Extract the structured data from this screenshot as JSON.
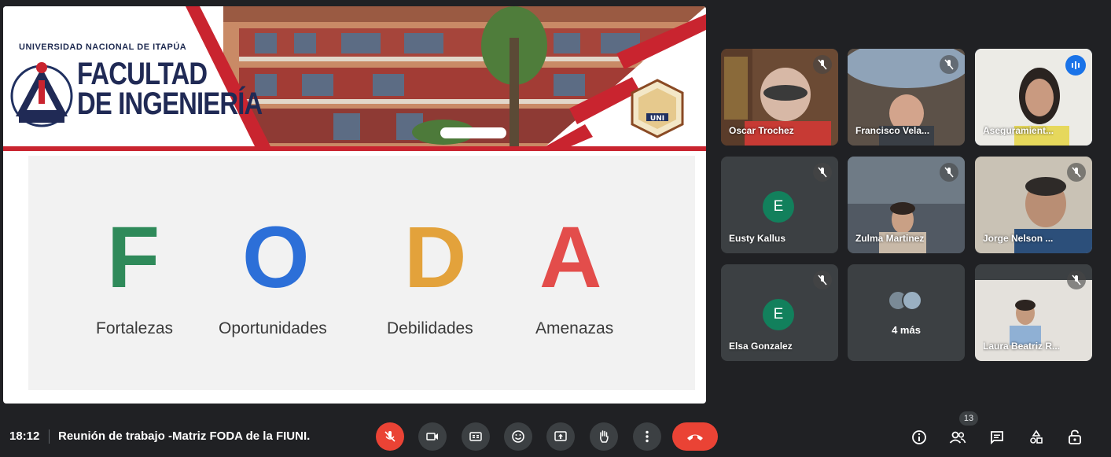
{
  "slide": {
    "university": "UNIVERSIDAD NACIONAL DE ITAPÚA",
    "faculty_line1": "FACULTAD",
    "faculty_line2": "DE INGENIERÍA",
    "seal_text": "UNI",
    "foda": [
      {
        "letter": "F",
        "word": "Fortalezas",
        "color": "#2f8a5a"
      },
      {
        "letter": "O",
        "word": "Oportunidades",
        "color": "#2c6fd8"
      },
      {
        "letter": "D",
        "word": "Debilidades",
        "color": "#e3a23b"
      },
      {
        "letter": "A",
        "word": "Amenazas",
        "color": "#e34d4b"
      }
    ]
  },
  "participants": [
    {
      "name": "Oscar Trochez",
      "muted": true,
      "video": true
    },
    {
      "name": "Francisco Vela...",
      "muted": true,
      "video": true
    },
    {
      "name": "Aseguramient...",
      "muted": false,
      "speaking": true,
      "video": true
    },
    {
      "name": "Eusty Kallus",
      "muted": true,
      "video": false,
      "initial": "E"
    },
    {
      "name": "Zulma Martinez",
      "muted": true,
      "video": true
    },
    {
      "name": "Jorge Nelson ...",
      "muted": true,
      "video": true
    },
    {
      "name": "Elsa Gonzalez",
      "muted": true,
      "video": false,
      "initial": "E"
    },
    {
      "name": "4 más",
      "more": true
    },
    {
      "name": "Laura Beatriz R...",
      "muted": true,
      "video": true
    }
  ],
  "bottom_bar": {
    "time": "18:12",
    "meeting_title": "Reunión de trabajo -Matriz FODA de la FIUNI.",
    "people_count": "13",
    "controls": [
      "mic-off-icon",
      "camera-icon",
      "captions-icon",
      "emoji-icon",
      "present-icon",
      "raise-hand-icon",
      "more-options-icon",
      "hang-up-icon"
    ],
    "right_icons": [
      "info-icon",
      "people-icon",
      "chat-icon",
      "activities-icon",
      "host-controls-icon"
    ]
  },
  "colors": {
    "background": "#202124",
    "tile": "#3c4043",
    "danger": "#ea4335",
    "speaking": "#1a73e8",
    "avatar": "#12805c"
  }
}
